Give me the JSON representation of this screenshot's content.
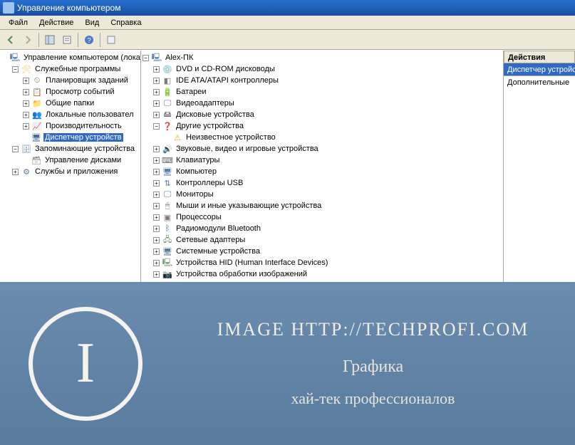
{
  "titlebar": {
    "text": "Управление компьютером"
  },
  "menu": {
    "file": "Файл",
    "action": "Действие",
    "view": "Вид",
    "help": "Справка"
  },
  "left_tree": {
    "root": "Управление компьютером (лока",
    "system_tools": "Служебные программы",
    "scheduler": "Планировщик заданий",
    "event_viewer": "Просмотр событий",
    "shared_folders": "Общие папки",
    "local_users": "Локальные пользовател",
    "performance": "Производительность",
    "device_manager": "Диспетчер устройств",
    "storage": "Запоминающие устройства",
    "disk_mgmt": "Управление дисками",
    "services": "Службы и приложения"
  },
  "mid_tree": {
    "root": "Alex-ПК",
    "dvd": "DVD и CD-ROM дисководы",
    "ide": "IDE ATA/ATAPI контроллеры",
    "battery": "Батареи",
    "video": "Видеоадаптеры",
    "disk": "Дисковые устройства",
    "other": "Другие устройства",
    "unknown": "Неизвестное устройство",
    "sound": "Звуковые, видео и игровые устройства",
    "keyboard": "Клавиатуры",
    "computer": "Компьютер",
    "usb": "Контроллеры USB",
    "monitor": "Мониторы",
    "mouse": "Мыши и иные указывающие устройства",
    "cpu": "Процессоры",
    "bluetooth": "Радиомодули Bluetooth",
    "network": "Сетевые адаптеры",
    "system": "Системные устройства",
    "hid": "Устройства HID (Human Interface Devices)",
    "imaging": "Устройства обработки изображений"
  },
  "right_panel": {
    "header": "Действия",
    "active": "Диспетчер устройс",
    "more": "Дополнительные"
  },
  "watermark": {
    "letter": "I",
    "line1": "IMAGE HTTP://TECHPROFI.COM",
    "line2": "Графика",
    "line3": "хай-тек профессионалов"
  }
}
